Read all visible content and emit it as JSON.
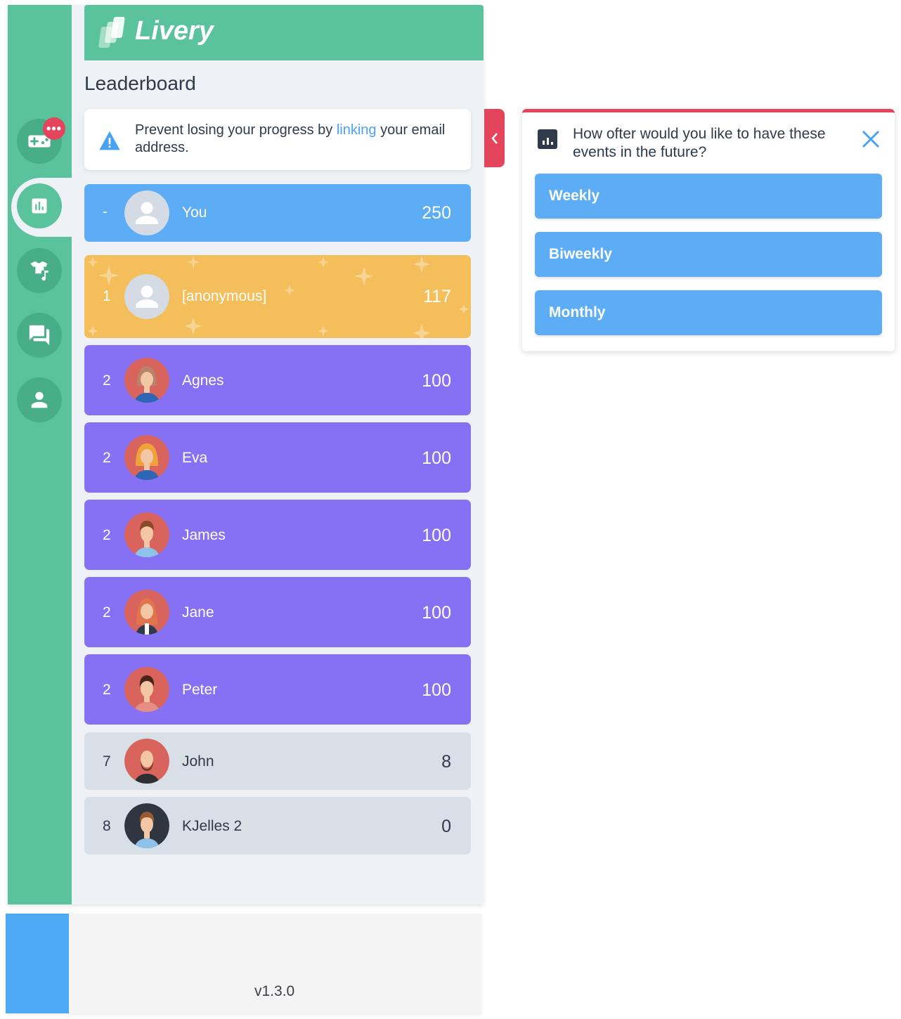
{
  "app": {
    "brand": "Livery",
    "colors": {
      "primary": "#5ac29c",
      "accent_blue": "#5dadf6",
      "alert": "#e5455c",
      "gold": "#f4be5a",
      "purple": "#8670f4"
    }
  },
  "sidebar": {
    "items": [
      {
        "icon": "gamepad-icon",
        "badge": "•••"
      },
      {
        "icon": "leaderboard-icon",
        "active": true
      },
      {
        "icon": "shirt-music-icon"
      },
      {
        "icon": "chat-icon"
      },
      {
        "icon": "user-icon"
      }
    ]
  },
  "page": {
    "title": "Leaderboard"
  },
  "warning": {
    "text_before": "Prevent losing your progress by ",
    "link": "linking",
    "text_after": " your email address."
  },
  "leaderboard": [
    {
      "rank": "-",
      "name": "You",
      "score": "250"
    },
    {
      "rank": "1",
      "name": "[anonymous]",
      "score": "117"
    },
    {
      "rank": "2",
      "name": "Agnes",
      "score": "100"
    },
    {
      "rank": "2",
      "name": "Eva",
      "score": "100"
    },
    {
      "rank": "2",
      "name": "James",
      "score": "100"
    },
    {
      "rank": "2",
      "name": "Jane",
      "score": "100"
    },
    {
      "rank": "2",
      "name": "Peter",
      "score": "100"
    },
    {
      "rank": "7",
      "name": "John",
      "score": "8"
    },
    {
      "rank": "8",
      "name": "KJelles 2",
      "score": "0"
    }
  ],
  "footer": {
    "version": "v1.3.0"
  },
  "survey": {
    "question": "How ofter would you like to have these events in the future?",
    "options": [
      "Weekly",
      "Biweekly",
      "Monthly"
    ]
  }
}
